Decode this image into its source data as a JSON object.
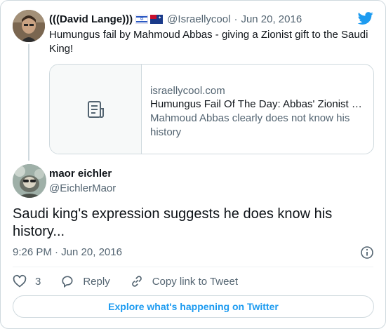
{
  "parent_tweet": {
    "author_name": "(((David Lange)))",
    "handle": "@Israellycool",
    "separator": "·",
    "date": "Jun 20, 2016",
    "text": "Humungus fail by Mahmoud Abbas - giving a Zionist gift to the Saudi King!",
    "link_card": {
      "domain": "israellycool.com",
      "title": "Humungus Fail Of The Day: Abbas' Zionist …",
      "description": "Mahmoud Abbas clearly does not know his history"
    }
  },
  "main_tweet": {
    "author_name": "maor eichler",
    "handle": "@EichlerMaor",
    "text": "Saudi king's expression suggests he does know his history...",
    "timestamp": "9:26 PM · Jun 20, 2016"
  },
  "actions": {
    "like_count": "3",
    "reply_label": "Reply",
    "copy_link_label": "Copy link to Tweet"
  },
  "explore_label": "Explore what's happening on Twitter",
  "colors": {
    "twitter_blue": "#1d9bf0",
    "secondary_text": "#536471",
    "border": "#cfd9de"
  }
}
